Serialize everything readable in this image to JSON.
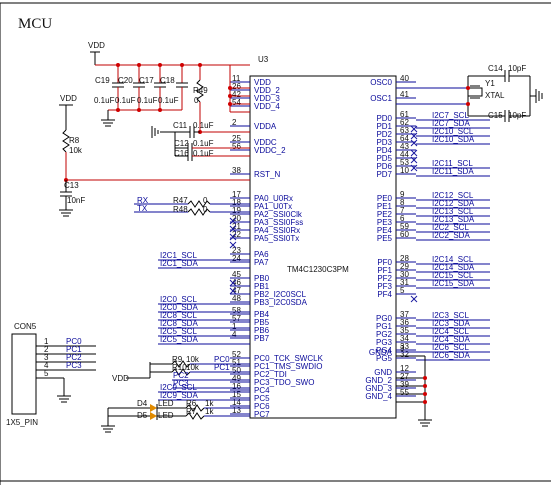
{
  "title": "MCU",
  "net": {
    "vdd_top": "VDD",
    "vdd_left": "VDD",
    "vdd_con": "VDD"
  },
  "chip": {
    "ref": "U3",
    "part": "TM4C1230C3PM",
    "left_pins": [
      {
        "num": "11",
        "name": "VDD"
      },
      {
        "num": "26",
        "name": "VDD_2"
      },
      {
        "num": "42",
        "name": "VDD_3"
      },
      {
        "num": "54",
        "name": "VDD_4"
      },
      {
        "num": "2",
        "name": "VDDA"
      },
      {
        "num": "25",
        "name": "VDDC"
      },
      {
        "num": "56",
        "name": "VDDC_2"
      },
      {
        "num": "38",
        "name": "RST_N"
      },
      {
        "num": "17",
        "name": "PA0_U0Rx"
      },
      {
        "num": "18",
        "name": "PA1_U0Tx"
      },
      {
        "num": "19",
        "name": "PA2_SSI0Clk"
      },
      {
        "num": "20",
        "name": "PA3_SSI0Fss"
      },
      {
        "num": "21",
        "name": "PA4_SSI0Rx"
      },
      {
        "num": "22",
        "name": "PA5_SSI0Tx"
      },
      {
        "num": "23",
        "name": "PA6"
      },
      {
        "num": "24",
        "name": "PA7"
      },
      {
        "num": "45",
        "name": "PB0"
      },
      {
        "num": "46",
        "name": "PB1"
      },
      {
        "num": "47",
        "name": "PB2_I2C0SCL"
      },
      {
        "num": "48",
        "name": "PB3_I2C0SDA"
      },
      {
        "num": "58",
        "name": "PB4"
      },
      {
        "num": "57",
        "name": "PB5"
      },
      {
        "num": "1",
        "name": "PB6"
      },
      {
        "num": "4",
        "name": "PB7"
      },
      {
        "num": "52",
        "name": "PC0_TCK_SWCLK"
      },
      {
        "num": "51",
        "name": "PC1_TMS_SWDIO"
      },
      {
        "num": "50",
        "name": "PC2_TDI"
      },
      {
        "num": "49",
        "name": "PC3_TDO_SWO"
      },
      {
        "num": "16",
        "name": "PC4"
      },
      {
        "num": "15",
        "name": "PC5"
      },
      {
        "num": "14",
        "name": "PC6"
      },
      {
        "num": "13",
        "name": "PC7"
      }
    ],
    "right_pins": [
      {
        "num": "40",
        "name": "OSC0"
      },
      {
        "num": "41",
        "name": "OSC1"
      },
      {
        "num": "61",
        "name": "PD0"
      },
      {
        "num": "62",
        "name": "PD1"
      },
      {
        "num": "63",
        "name": "PD2"
      },
      {
        "num": "64",
        "name": "PD3"
      },
      {
        "num": "43",
        "name": "PD4"
      },
      {
        "num": "44",
        "name": "PD5"
      },
      {
        "num": "53",
        "name": "PD6"
      },
      {
        "num": "10",
        "name": "PD7"
      },
      {
        "num": "9",
        "name": "PE0"
      },
      {
        "num": "8",
        "name": "PE1"
      },
      {
        "num": "7",
        "name": "PE2"
      },
      {
        "num": "6",
        "name": "PE3"
      },
      {
        "num": "59",
        "name": "PE4"
      },
      {
        "num": "60",
        "name": "PE5"
      },
      {
        "num": "28",
        "name": "PF0"
      },
      {
        "num": "29",
        "name": "PF1"
      },
      {
        "num": "30",
        "name": "PF2"
      },
      {
        "num": "31",
        "name": "PF3"
      },
      {
        "num": "5",
        "name": "PF4"
      },
      {
        "num": "37",
        "name": "PG0"
      },
      {
        "num": "36",
        "name": "PG1"
      },
      {
        "num": "35",
        "name": "PG2"
      },
      {
        "num": "34",
        "name": "PG3"
      },
      {
        "num": "33",
        "name": "PG4"
      },
      {
        "num": "32",
        "name": "PG5"
      },
      {
        "num": "3",
        "name": "GNDA"
      },
      {
        "num": "12",
        "name": "GND"
      },
      {
        "num": "27",
        "name": "GND_2"
      },
      {
        "num": "39",
        "name": "GND_3"
      },
      {
        "num": "55",
        "name": "GND_4"
      }
    ]
  },
  "right_nets": [
    "I2C7_SCL",
    "I2C7_SDA",
    "I2C10_SCL",
    "I2C10_SDA",
    "I2C11_SCL",
    "I2C11_SDA",
    "I2C12_SCL",
    "I2C12_SDA",
    "I2C13_SCL",
    "I2C13_SDA",
    "I2C2_SCL",
    "I2C2_SDA",
    "I2C14_SCL",
    "I2C14_SDA",
    "I2C15_SCL",
    "I2C15_SDA",
    "I2C3_SCL",
    "I2C3_SDA",
    "I2C4_SCL",
    "I2C4_SDA",
    "I2C6_SCL",
    "I2C6_SDA"
  ],
  "left_nets": {
    "rx": "RX",
    "tx": "TX",
    "a6": "I2C1_SCL",
    "a7": "I2C1_SDA",
    "b2": "I2C0_SCL",
    "b3": "I2C0_SDA",
    "b4": "I2C8_SCL",
    "b5": "I2C8_SDA",
    "b6": "I2C5_SCL",
    "b7": "I2C5_SDA",
    "c0": "PC0",
    "c1": "PC1",
    "c2": "PC2",
    "c3": "PC3",
    "c4": "I2C9_SCL",
    "c5": "I2C9_SDA"
  },
  "caps": [
    {
      "ref": "C19",
      "val": "0.1uF"
    },
    {
      "ref": "C20",
      "val": "0.1uF"
    },
    {
      "ref": "C17",
      "val": "0.1uF"
    },
    {
      "ref": "C18",
      "val": "0.1uF"
    },
    {
      "ref": "C11",
      "val": "0.1uF"
    },
    {
      "ref": "C12",
      "val": "0.1uF"
    },
    {
      "ref": "C16",
      "val": "0.1uF"
    },
    {
      "ref": "C13",
      "val": "10nF"
    },
    {
      "ref": "C14",
      "val": "10pF"
    },
    {
      "ref": "C15",
      "val": "10pF"
    }
  ],
  "resistors": [
    {
      "ref": "R49",
      "val": "0"
    },
    {
      "ref": "R8",
      "val": "10k"
    },
    {
      "ref": "R47",
      "val": "0"
    },
    {
      "ref": "R48",
      "val": "0"
    },
    {
      "ref": "R9",
      "val": "10k"
    },
    {
      "ref": "R10",
      "val": "10k"
    },
    {
      "ref": "R6",
      "val": "1k"
    },
    {
      "ref": "R7",
      "val": "1k"
    }
  ],
  "crystal": {
    "ref": "Y1",
    "val": "XTAL"
  },
  "leds": [
    {
      "ref": "D4",
      "val": "LED"
    },
    {
      "ref": "D5",
      "val": "LED"
    }
  ],
  "connector": {
    "ref": "CON5",
    "part": "1X5_PIN",
    "pins": [
      {
        "num": "1",
        "net": "PC0"
      },
      {
        "num": "2",
        "net": "PC1"
      },
      {
        "num": "3",
        "net": "PC2"
      },
      {
        "num": "4",
        "net": "PC3"
      },
      {
        "num": "5",
        "net": ""
      }
    ]
  }
}
